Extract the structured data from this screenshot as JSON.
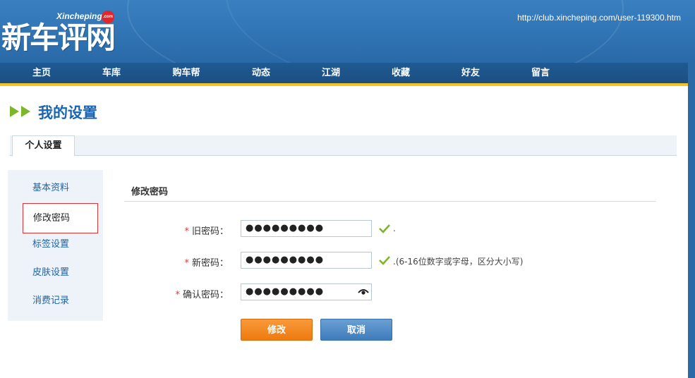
{
  "header": {
    "logo_sub": "Xincheping",
    "logo_badge": ".com",
    "logo_main": "新车评网",
    "url": "http://club.xincheping.com/user-119300.htm"
  },
  "nav": {
    "items": [
      "主页",
      "车库",
      "购车帮",
      "动态",
      "江湖",
      "收藏",
      "好友",
      "留言"
    ]
  },
  "page": {
    "title": "我的设置"
  },
  "tabs": {
    "active": "个人设置"
  },
  "sidebar": {
    "items": [
      "基本资料",
      "修改密码",
      "标签设置",
      "皮肤设置",
      "消费记录"
    ],
    "active_item": "修改密码"
  },
  "form": {
    "section_title": "修改密码",
    "required_mark": "*",
    "old_password": {
      "label": "旧密码：",
      "value": "●●●●●●●●●",
      "hint": "."
    },
    "new_password": {
      "label": "新密码：",
      "value": "●●●●●●●●●",
      "hint": ".(6-16位数字或字母，区分大小写)"
    },
    "confirm_password": {
      "label": "确认密码：",
      "value": "●●●●●●●●●"
    },
    "submit_label": "修改",
    "cancel_label": "取消"
  },
  "icons": {
    "nav_arrows": "double-arrow-icon",
    "valid": "check-icon",
    "reveal": "eye-icon"
  },
  "colors": {
    "brand_blue": "#2f73b3",
    "title_blue": "#1a64b2",
    "nav_accent": "#f3c321",
    "submit_orange": "#ef7a10",
    "cancel_blue": "#3f7cbc",
    "check_green": "#7cb62b",
    "required_red": "#e23a3a"
  }
}
